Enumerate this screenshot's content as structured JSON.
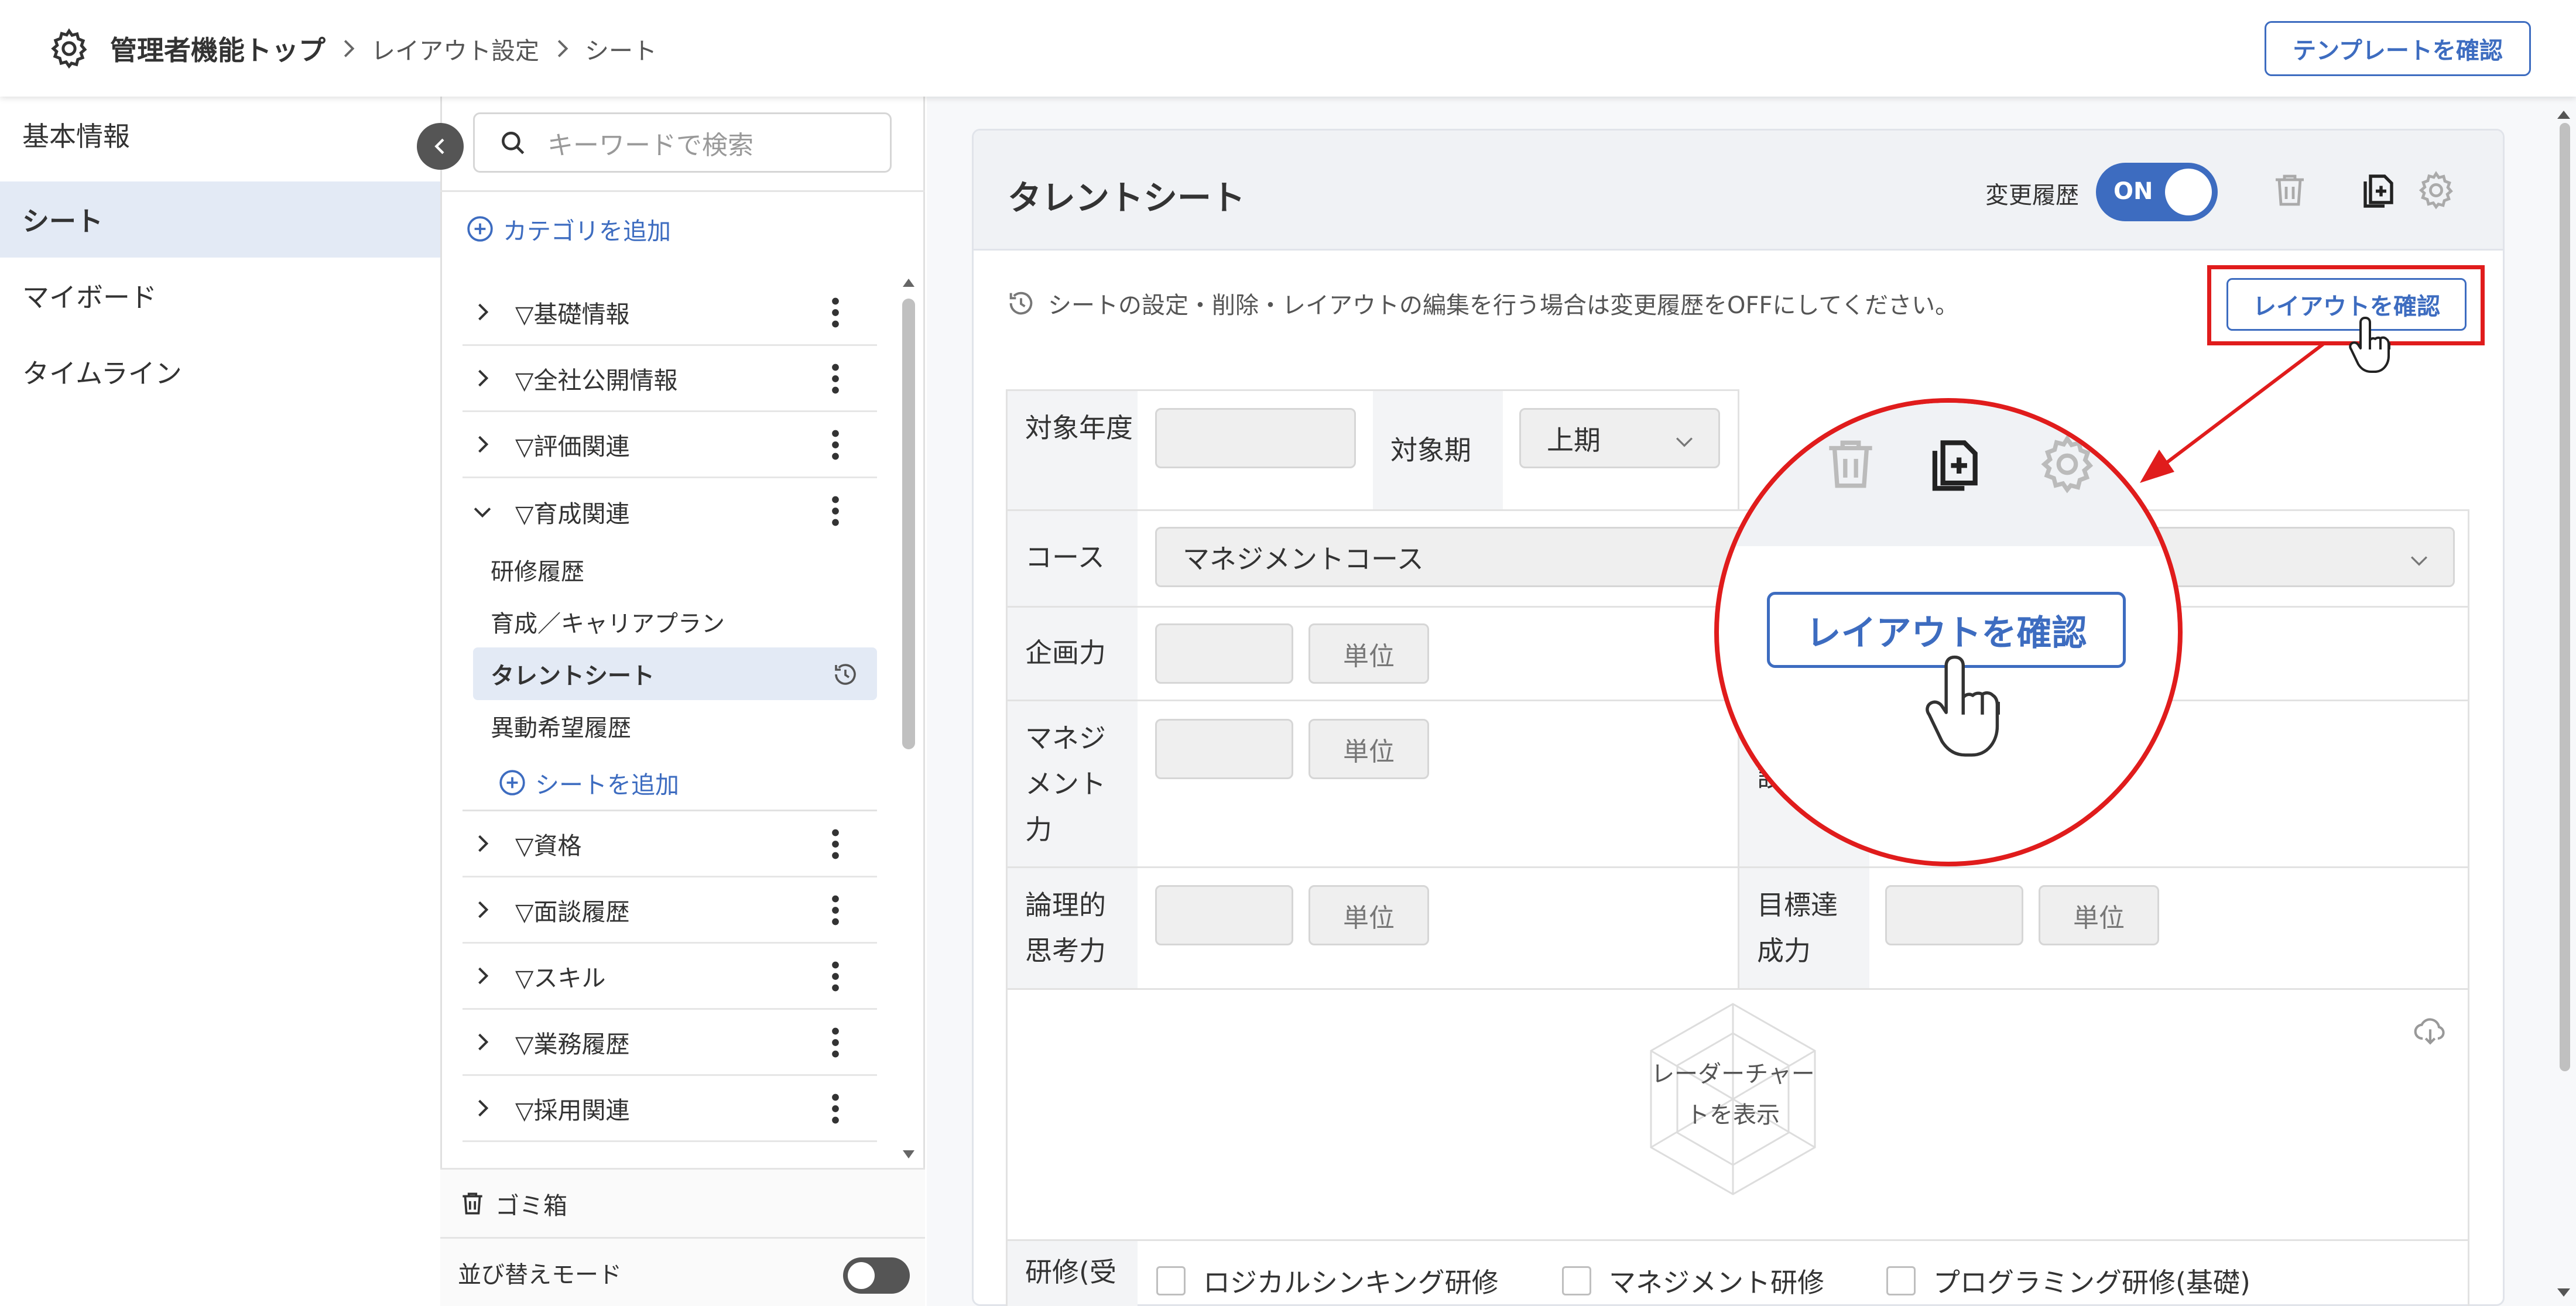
{
  "header": {
    "breadcrumb_top": "管理者機能トップ",
    "breadcrumb_1": "レイアウト設定",
    "breadcrumb_2": "シート",
    "template_button": "テンプレートを確認"
  },
  "left_nav": {
    "items": [
      "基本情報",
      "シート",
      "マイボード",
      "タイムライン"
    ],
    "active": "シート"
  },
  "sheet_tree": {
    "search_placeholder": "キーワードで検索",
    "add_category": "カテゴリを追加",
    "categories": [
      "▽基礎情報",
      "▽全社公開情報",
      "▽評価関連",
      "▽育成関連",
      "▽資格",
      "▽面談履歴",
      "▽スキル",
      "▽業務履歴",
      "▽採用関連"
    ],
    "expanded_category": "▽育成関連",
    "sub_items": [
      "研修履歴",
      "育成／キャリアプラン",
      "タレントシート",
      "異動希望履歴"
    ],
    "active_sub": "タレントシート",
    "add_sheet": "シートを追加",
    "trash": "ゴミ箱",
    "sort_mode": "並び替えモード",
    "sort_mode_on": false
  },
  "panel": {
    "title": "タレントシート",
    "history_label": "変更履歴",
    "history_toggle": "ON",
    "notice": "シートの設定・削除・レイアウトの編集を行う場合は変更履歴をOFFにしてください。",
    "layout_button": "レイアウトを確認"
  },
  "form": {
    "year_label": "対象年度",
    "period_label": "対象期",
    "period_value": "上期",
    "course_label": "コース",
    "course_value": "マネジメントコース",
    "planning_label": "企画力",
    "management_label": "マネジメント力",
    "logical_label": "論理的思考力",
    "goal_label": "目標達成力",
    "partial_label": "設",
    "unit": "単位",
    "radar_text": "レーダーチャートを表示",
    "training_label": "研修(受",
    "checkboxes": [
      "ロジカルシンキング研修",
      "マネジメント研修",
      "プログラミング研修(基礎)"
    ]
  },
  "zoom": {
    "button": "レイアウトを確認"
  },
  "colors": {
    "accent": "#3d6cc0",
    "highlight": "#e01c1c",
    "active_bg": "#e3eaf5"
  }
}
